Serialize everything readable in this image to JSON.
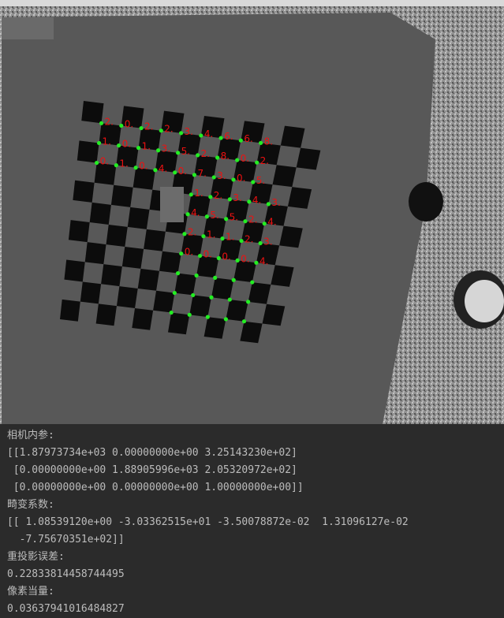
{
  "output": {
    "intrinsics_label": "相机内参:",
    "camera_matrix": [
      "[[1.87973734e+03 0.00000000e+00 3.25143230e+02]",
      " [0.00000000e+00 1.88905996e+03 2.05320972e+02]",
      " [0.00000000e+00 0.00000000e+00 1.00000000e+00]]"
    ],
    "distortion_label": "畸变系数:",
    "distortion_coeffs": [
      "[[ 1.08539120e+00 -3.03362515e+01 -3.50078872e-02  1.31096127e-02",
      "  -7.75670351e+02]]"
    ],
    "reprojection_label": "重投影误差:",
    "reprojection_error": "0.22833814458744495",
    "pixel_equivalent_label": "像素当量:",
    "pixel_equivalent": "0.03637941016484827"
  },
  "image": {
    "corner_labels": [
      "2.",
      "0.",
      "2.",
      "2.",
      "3.",
      "4.",
      "6.",
      "6.",
      "8.",
      "1.",
      "0.",
      "1.",
      "3.",
      "5.",
      "2.",
      "8.",
      "0.",
      "2.",
      "0.",
      "1.",
      "0.",
      "4.",
      "0.",
      "7.",
      "3.",
      "0.",
      "5.",
      "1.",
      "2.",
      "3.",
      "4.",
      "3.",
      "4.",
      "5.",
      "5.",
      "2.",
      "4.",
      "2.",
      "1.",
      "1.",
      "2.",
      "3.",
      "0.",
      "0.",
      "0.",
      "0.",
      "4."
    ]
  },
  "colors": {
    "corner_dot": "#22ee22",
    "corner_label": "#ee1111",
    "console_bg": "#2b2b2b",
    "console_text": "#bcbcbc"
  }
}
